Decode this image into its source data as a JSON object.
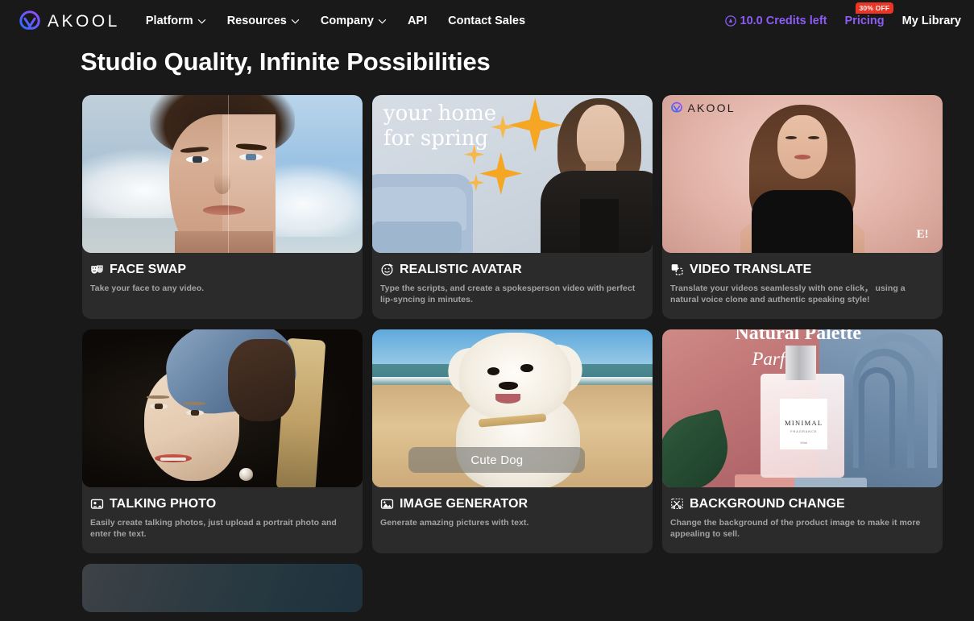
{
  "brand": {
    "name": "AKOOL",
    "logo_icon": "akool-logo-mark",
    "logo_gradient_from": "#2b6cff",
    "logo_gradient_to": "#8b5cf6"
  },
  "header": {
    "nav": [
      {
        "label": "Platform",
        "has_dropdown": true,
        "icon": "chevron-down-icon"
      },
      {
        "label": "Resources",
        "has_dropdown": true,
        "icon": "chevron-down-icon"
      },
      {
        "label": "Company",
        "has_dropdown": true,
        "icon": "chevron-down-icon"
      },
      {
        "label": "API",
        "has_dropdown": false
      },
      {
        "label": "Contact Sales",
        "has_dropdown": false
      }
    ],
    "credits": {
      "icon": "credit-coin-icon",
      "label": "10.0 Credits left",
      "color": "#8b5cf6"
    },
    "pricing": {
      "label": "Pricing",
      "badge": "30% OFF",
      "badge_color": "#ee3424",
      "color": "#8b5cf6"
    },
    "my_library": {
      "label": "My Library"
    }
  },
  "page": {
    "title": "Studio Quality, Infinite Possibilities",
    "background": "#191919",
    "card_background": "#2b2b2b"
  },
  "cards": [
    {
      "id": "face-swap",
      "icon": "theater-masks-icon",
      "title": "FACE SWAP",
      "description": "Take your face to any video."
    },
    {
      "id": "realistic-avatar",
      "icon": "smiley-face-icon",
      "title": "REALISTIC AVATAR",
      "description": "Type the scripts, and create a spokesperson video with perfect lip-syncing in minutes.",
      "thumb_text_line1": "your home",
      "thumb_text_line2": "for spring"
    },
    {
      "id": "video-translate",
      "icon": "translate-panels-icon",
      "title": "VIDEO TRANSLATE",
      "description": "Translate your videos seamlessly with one click， using a natural voice clone and authentic speaking style!",
      "thumb_watermark": "AKOOL",
      "thumb_logo": "E!"
    },
    {
      "id": "talking-photo",
      "icon": "portrait-photo-icon",
      "title": "TALKING PHOTO",
      "description": "Easily create talking photos, just upload a portrait photo and enter the text."
    },
    {
      "id": "image-generator",
      "icon": "image-sparkle-icon",
      "title": "IMAGE GENERATOR",
      "description": "Generate amazing pictures with text.",
      "thumb_caption": "Cute Dog"
    },
    {
      "id": "background-change",
      "icon": "scissors-crop-icon",
      "title": "BACKGROUND CHANGE",
      "description": "Change the background of the product image to make it more appealing to sell.",
      "thumb_title1": "Natural Palette",
      "thumb_title2": "Parfum",
      "thumb_label_brand": "MINIMAL",
      "thumb_label_sub": "FRAGRANCE",
      "thumb_label_size": "50ml"
    }
  ],
  "partial_card": {
    "id": "next-feature",
    "visible_label": ""
  }
}
